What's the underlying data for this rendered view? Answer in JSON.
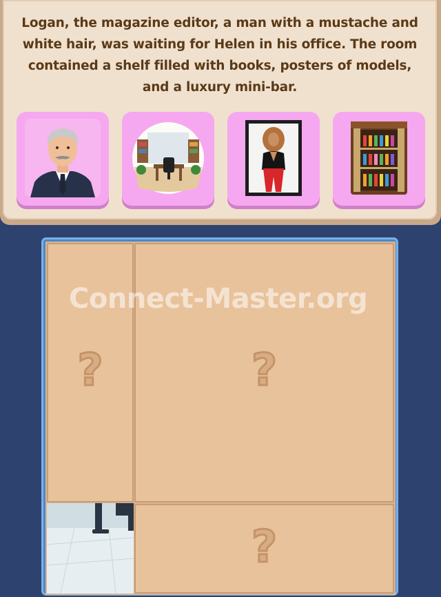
{
  "story": {
    "text": "Logan, the magazine editor, a man with a mustache and white hair, was waiting for Helen in his office. The room contained a shelf filled with books, posters of models, and a luxury mini-bar."
  },
  "cards": [
    {
      "icon": "man-portrait-icon"
    },
    {
      "icon": "office-room-icon"
    },
    {
      "icon": "model-poster-icon"
    },
    {
      "icon": "mini-bar-icon"
    }
  ],
  "board": {
    "watermark": "Connect-Master.org",
    "tiles": [
      {
        "label": "?"
      },
      {
        "label": "?"
      },
      {
        "label": "?"
      }
    ]
  },
  "colors": {
    "background": "#2e4270",
    "panel": "#f0e1cf",
    "card": "#f5a8ef",
    "tile": "#e8c29b",
    "board_border": "#4d87c7",
    "text": "#5a3a17"
  }
}
